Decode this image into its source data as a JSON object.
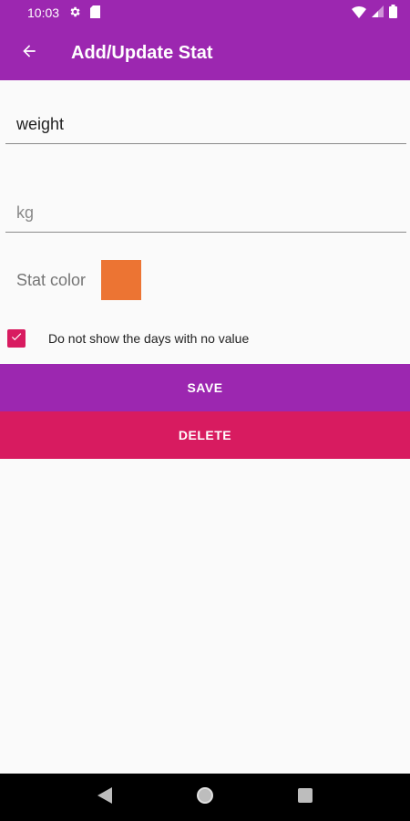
{
  "status_bar": {
    "time": "10:03",
    "icons": [
      "gear-icon",
      "sd-card-icon",
      "wifi-icon",
      "signal-icon",
      "battery-icon"
    ]
  },
  "app_bar": {
    "title": "Add/Update Stat",
    "back_icon": "arrow-back-icon"
  },
  "form": {
    "name_field": {
      "value": "weight",
      "placeholder": ""
    },
    "unit_field": {
      "value": "",
      "placeholder": "kg"
    },
    "color_label": "Stat color",
    "color_value": "#ec7433",
    "hide_empty_days": {
      "checked": true,
      "label": "Do not show the days with no value"
    }
  },
  "actions": {
    "save_label": "SAVE",
    "delete_label": "DELETE"
  },
  "nav_bar": {
    "icons": [
      "back-triangle-icon",
      "home-circle-icon",
      "recents-square-icon"
    ]
  },
  "colors": {
    "primary": "#9c27b0",
    "accent": "#d81b60",
    "background": "#fafafa"
  }
}
